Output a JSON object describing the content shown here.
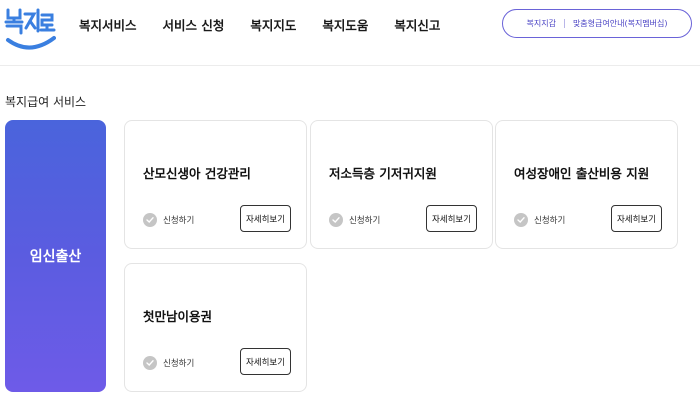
{
  "header": {
    "logo_text": "복지로",
    "nav": [
      "복지서비스",
      "서비스 신청",
      "복지지도",
      "복지도움",
      "복지신고"
    ],
    "util_links": [
      "복지지갑",
      "맞춤형급여안내(복지멤버십)"
    ]
  },
  "section_title": "복지급여 서비스",
  "category_label": "임신출산",
  "cards": [
    {
      "title": "산모신생아 건강관리",
      "apply_label": "신청하기",
      "detail_label": "자세히보기"
    },
    {
      "title": "저소득층 기저귀지원",
      "apply_label": "신청하기",
      "detail_label": "자세히보기"
    },
    {
      "title": "여성장애인 출산비용 지원",
      "apply_label": "신청하기",
      "detail_label": "자세히보기"
    },
    {
      "title": "첫만남이용권",
      "apply_label": "신청하기",
      "detail_label": "자세히보기"
    }
  ],
  "colors": {
    "brand_blue": "#3a7fe0",
    "accent_purple": "#6a63d8",
    "category_gradient": [
      "#4a64dc",
      "#6e5be8"
    ]
  }
}
